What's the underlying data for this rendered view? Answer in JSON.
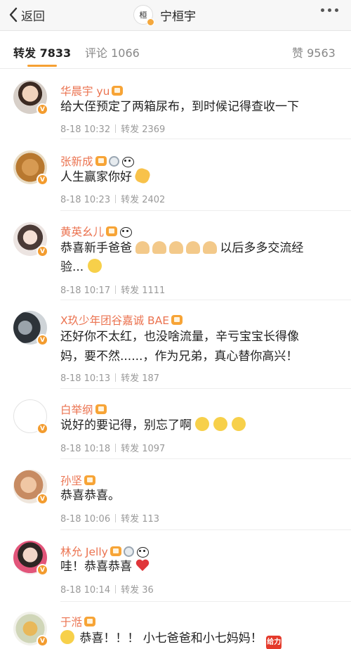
{
  "topbar": {
    "back_label": "返回",
    "title": "宁桓宇",
    "title_avatar_text": "桓"
  },
  "tabs": {
    "repost": "转发 7833",
    "comment": "评论 1066",
    "like": "赞 9563"
  },
  "accent": "#f6a033",
  "items": [
    {
      "name": "华晨宇 yu",
      "text": "给大侄预定了两箱尿布，到时候记得查收一下",
      "time": "8-18 10:32",
      "repost": "转发 2369"
    },
    {
      "name": "张新成",
      "text": "人生赢家你好",
      "time": "8-18 10:23",
      "repost": "转发 2402"
    },
    {
      "name": "黄英幺儿",
      "text1": "恭喜新手爸爸",
      "text1b": "以后多多交流经",
      "text2": "验...",
      "time": "8-18 10:17",
      "repost": "转发 1111"
    },
    {
      "name": "X玖少年团谷嘉诚 BAE",
      "text1": "还好你不太红，也没啥流量，辛亏宝宝长得像",
      "text2": "妈，要不然......，作为兄弟，真心替你高兴！",
      "time": "8-18 10:13",
      "repost": "转发 187"
    },
    {
      "name": "白举纲",
      "text": "说好的要记得，别忘了啊",
      "time": "8-18 10:18",
      "repost": "转发 1097"
    },
    {
      "name": "孙坚",
      "text": "恭喜恭喜。",
      "time": "8-18 10:06",
      "repost": "转发 113"
    },
    {
      "name": "林允 Jelly",
      "text": "哇！恭喜恭喜",
      "time": "8-18 10:14",
      "repost": "转发 36"
    },
    {
      "name": "于湉",
      "text": "恭喜！！！ 小七爸爸和小七妈妈！",
      "geili": "给力"
    }
  ]
}
